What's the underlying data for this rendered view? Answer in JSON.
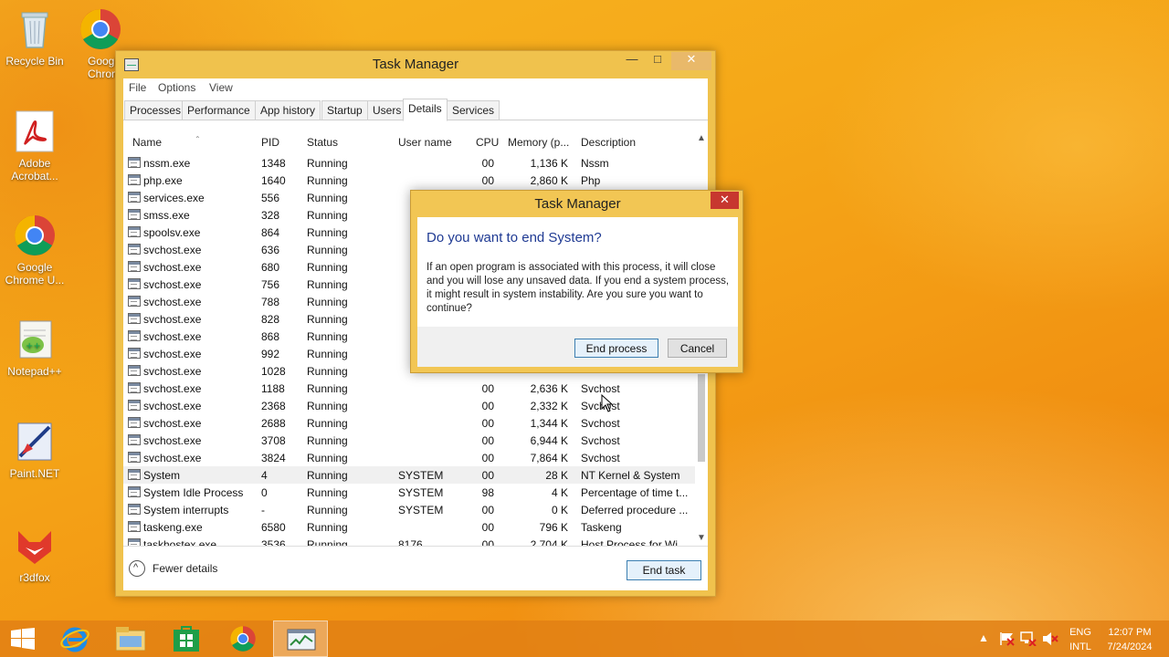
{
  "desktop": {
    "icons": [
      {
        "label": "Recycle Bin"
      },
      {
        "label": "Google Chrome"
      },
      {
        "label": "Adobe Acrobat..."
      },
      {
        "label": "Google Chrome U..."
      },
      {
        "label": "Notepad++"
      },
      {
        "label": "Paint.NET"
      },
      {
        "label": "r3dfox"
      }
    ]
  },
  "task_manager": {
    "title": "Task Manager",
    "menu": [
      "File",
      "Options",
      "View"
    ],
    "tabs": [
      "Processes",
      "Performance",
      "App history",
      "Startup",
      "Users",
      "Details",
      "Services"
    ],
    "active_tab": "Details",
    "columns": [
      "Name",
      "PID",
      "Status",
      "User name",
      "CPU",
      "Memory (p...",
      "Description"
    ],
    "rows": [
      {
        "name": "nssm.exe",
        "pid": "1348",
        "status": "Running",
        "user": "",
        "cpu": "00",
        "mem": "1,136 K",
        "desc": "Nssm"
      },
      {
        "name": "php.exe",
        "pid": "1640",
        "status": "Running",
        "user": "",
        "cpu": "00",
        "mem": "2,860 K",
        "desc": "Php"
      },
      {
        "name": "services.exe",
        "pid": "556",
        "status": "Running",
        "user": "",
        "cpu": "",
        "mem": "",
        "desc": ""
      },
      {
        "name": "smss.exe",
        "pid": "328",
        "status": "Running",
        "user": "",
        "cpu": "",
        "mem": "",
        "desc": ""
      },
      {
        "name": "spoolsv.exe",
        "pid": "864",
        "status": "Running",
        "user": "",
        "cpu": "",
        "mem": "",
        "desc": ""
      },
      {
        "name": "svchost.exe",
        "pid": "636",
        "status": "Running",
        "user": "",
        "cpu": "",
        "mem": "",
        "desc": ""
      },
      {
        "name": "svchost.exe",
        "pid": "680",
        "status": "Running",
        "user": "",
        "cpu": "",
        "mem": "",
        "desc": ""
      },
      {
        "name": "svchost.exe",
        "pid": "756",
        "status": "Running",
        "user": "",
        "cpu": "",
        "mem": "",
        "desc": ""
      },
      {
        "name": "svchost.exe",
        "pid": "788",
        "status": "Running",
        "user": "",
        "cpu": "",
        "mem": "",
        "desc": ""
      },
      {
        "name": "svchost.exe",
        "pid": "828",
        "status": "Running",
        "user": "",
        "cpu": "",
        "mem": "",
        "desc": ""
      },
      {
        "name": "svchost.exe",
        "pid": "868",
        "status": "Running",
        "user": "",
        "cpu": "",
        "mem": "",
        "desc": ""
      },
      {
        "name": "svchost.exe",
        "pid": "992",
        "status": "Running",
        "user": "",
        "cpu": "",
        "mem": "",
        "desc": ""
      },
      {
        "name": "svchost.exe",
        "pid": "1028",
        "status": "Running",
        "user": "",
        "cpu": "",
        "mem": "",
        "desc": ""
      },
      {
        "name": "svchost.exe",
        "pid": "1188",
        "status": "Running",
        "user": "",
        "cpu": "00",
        "mem": "2,636 K",
        "desc": "Svchost"
      },
      {
        "name": "svchost.exe",
        "pid": "2368",
        "status": "Running",
        "user": "",
        "cpu": "00",
        "mem": "2,332 K",
        "desc": "Svchost"
      },
      {
        "name": "svchost.exe",
        "pid": "2688",
        "status": "Running",
        "user": "",
        "cpu": "00",
        "mem": "1,344 K",
        "desc": "Svchost"
      },
      {
        "name": "svchost.exe",
        "pid": "3708",
        "status": "Running",
        "user": "",
        "cpu": "00",
        "mem": "6,944 K",
        "desc": "Svchost"
      },
      {
        "name": "svchost.exe",
        "pid": "3824",
        "status": "Running",
        "user": "",
        "cpu": "00",
        "mem": "7,864 K",
        "desc": "Svchost"
      },
      {
        "name": "System",
        "pid": "4",
        "status": "Running",
        "user": "SYSTEM",
        "cpu": "00",
        "mem": "28 K",
        "desc": "NT Kernel & System",
        "selected": true
      },
      {
        "name": "System Idle Process",
        "pid": "0",
        "status": "Running",
        "user": "SYSTEM",
        "cpu": "98",
        "mem": "4 K",
        "desc": "Percentage of time t..."
      },
      {
        "name": "System interrupts",
        "pid": "-",
        "status": "Running",
        "user": "SYSTEM",
        "cpu": "00",
        "mem": "0 K",
        "desc": "Deferred procedure ..."
      },
      {
        "name": "taskeng.exe",
        "pid": "6580",
        "status": "Running",
        "user": "",
        "cpu": "00",
        "mem": "796 K",
        "desc": "Taskeng"
      },
      {
        "name": "taskhostex.exe",
        "pid": "3536",
        "status": "Running",
        "user": "8176",
        "cpu": "00",
        "mem": "2,704 K",
        "desc": "Host Process for Wi..."
      }
    ],
    "fewer_details_label": "Fewer details",
    "end_task_label": "End task"
  },
  "dialog": {
    "title": "Task Manager",
    "heading": "Do you want to end System?",
    "message": "If an open program is associated with this process, it will close and you will lose any unsaved data. If you end a system process, it might result in system instability. Are you sure you want to continue?",
    "end_process_label": "End process",
    "cancel_label": "Cancel"
  },
  "taskbar": {
    "apps": [
      "start-icon",
      "internet-explorer-icon",
      "file-explorer-icon",
      "store-icon",
      "chrome-icon",
      "task-manager-icon"
    ],
    "language": "ENG",
    "layout": "INTL",
    "time": "12:07 PM",
    "date": "7/24/2024"
  }
}
